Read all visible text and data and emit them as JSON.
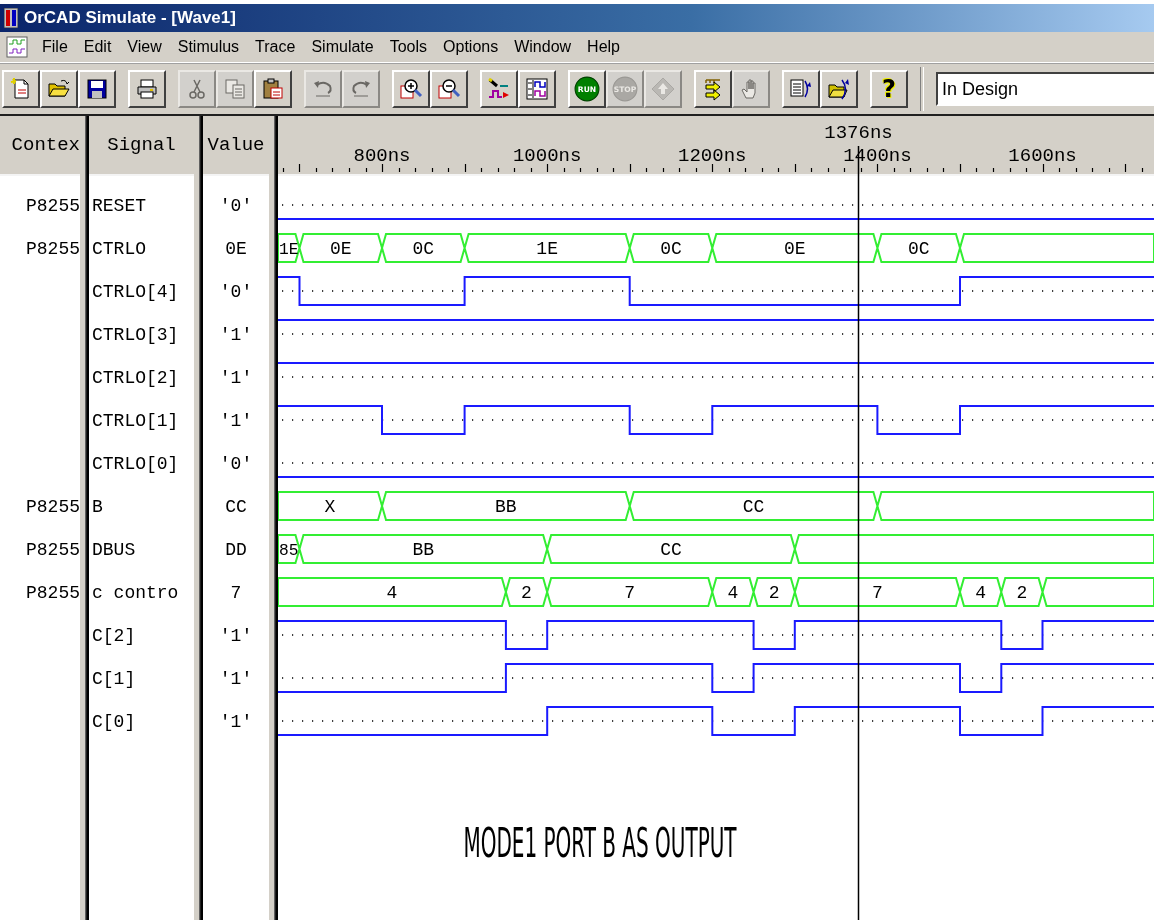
{
  "window": {
    "title": "OrCAD Simulate - [Wave1]"
  },
  "menu": [
    "File",
    "Edit",
    "View",
    "Stimulus",
    "Trace",
    "Simulate",
    "Tools",
    "Options",
    "Window",
    "Help"
  ],
  "toolbar": {
    "groups": [
      [
        {
          "kind": "new",
          "disabled": false
        },
        {
          "kind": "open",
          "disabled": false
        },
        {
          "kind": "save",
          "disabled": false
        }
      ],
      [
        {
          "kind": "print",
          "disabled": false
        }
      ],
      [
        {
          "kind": "cut",
          "disabled": true
        },
        {
          "kind": "copy",
          "disabled": true
        },
        {
          "kind": "paste",
          "disabled": false
        }
      ],
      [
        {
          "kind": "undo",
          "disabled": true
        },
        {
          "kind": "redo",
          "disabled": true
        }
      ],
      [
        {
          "kind": "zoom_in",
          "disabled": false
        },
        {
          "kind": "zoom_out",
          "disabled": false
        }
      ],
      [
        {
          "kind": "add_trace",
          "disabled": false
        },
        {
          "kind": "waveform",
          "disabled": false
        }
      ],
      [
        {
          "kind": "run",
          "label": "RUN",
          "disabled": false
        },
        {
          "kind": "stop",
          "label": "STOP",
          "disabled": true
        },
        {
          "kind": "up",
          "disabled": true
        }
      ],
      [
        {
          "kind": "step",
          "disabled": false
        },
        {
          "kind": "hand",
          "disabled": true
        }
      ],
      [
        {
          "kind": "doc_swap",
          "disabled": false
        },
        {
          "kind": "folder_swap",
          "disabled": false
        }
      ],
      [
        {
          "kind": "help",
          "label": "?",
          "disabled": false
        }
      ]
    ],
    "dropdown": {
      "value": "In Design"
    }
  },
  "columns": [
    "Contex",
    "Signal",
    "Value"
  ],
  "signals": [
    {
      "context": "P8255",
      "name": "RESET",
      "value": "'0'",
      "kind": "bit"
    },
    {
      "context": "P8255",
      "name": "CTRLO",
      "value": "0E",
      "kind": "bus",
      "labels": [
        "1E",
        "0E",
        "0C",
        "1E",
        "0C",
        "0E",
        "0C"
      ]
    },
    {
      "name": "CTRLO[4]",
      "value": "'0'",
      "kind": "bit"
    },
    {
      "name": "CTRLO[3]",
      "value": "'1'",
      "kind": "bit"
    },
    {
      "name": "CTRLO[2]",
      "value": "'1'",
      "kind": "bit"
    },
    {
      "name": "CTRLO[1]",
      "value": "'1'",
      "kind": "bit"
    },
    {
      "name": "CTRLO[0]",
      "value": "'0'",
      "kind": "bit"
    },
    {
      "context": "P8255",
      "name": "B",
      "value": "CC",
      "kind": "bus",
      "labels": [
        "X",
        "BB",
        "CC"
      ]
    },
    {
      "context": "P8255",
      "name": "DBUS",
      "value": "DD",
      "kind": "bus",
      "labels": [
        "85",
        "BB",
        "CC"
      ]
    },
    {
      "context": "P8255",
      "name": "c contro",
      "value": "7",
      "kind": "bus",
      "labels": [
        "4",
        "2",
        "7",
        "4",
        "2",
        "7",
        "4",
        "2"
      ]
    },
    {
      "name": "C[2]",
      "value": "'1'",
      "kind": "bit"
    },
    {
      "name": "C[1]",
      "value": "'1'",
      "kind": "bit"
    },
    {
      "name": "C[0]",
      "value": "'1'",
      "kind": "bit"
    }
  ],
  "waveform": {
    "ticks": [
      "800ns",
      "1000ns",
      "1200ns",
      "1400ns",
      "1600ns"
    ],
    "cursor": "1376ns",
    "note": "MODE1 PORT B AS OUTPUT"
  }
}
